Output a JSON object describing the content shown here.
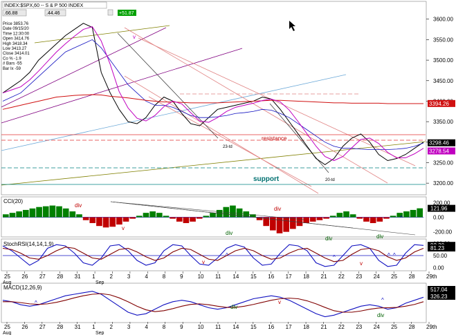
{
  "header": {
    "symbol_box": "INDEX:$SPX,60 -- S & P 500 INDEX",
    "left_val": ".66.88",
    "mid_val": ".44.46",
    "change": "+51.87"
  },
  "info": [
    "Price 3853.76",
    "Date 09/15/20",
    "Time 12:30:00",
    "Open 3414.76",
    "High 3418.34",
    "Low 3413.27",
    "Close 3414.01",
    "Co % -1.9",
    "# Bars -55",
    "Bar Ix -59"
  ],
  "chart_data": [
    {
      "type": "line",
      "panel": "price",
      "title": "",
      "ylim": [
        3175,
        3640
      ],
      "yticks": [
        3200,
        3250,
        3300,
        3350,
        3400,
        3450,
        3500,
        3550,
        3600
      ],
      "series": [
        {
          "values": [
            3420,
            3435,
            3450,
            3470,
            3500,
            3520,
            3540,
            3560,
            3575,
            3590,
            3580,
            3470,
            3420,
            3380,
            3350,
            3345,
            3360,
            3390,
            3410,
            3400,
            3370,
            3345,
            3340,
            3360,
            3380,
            3385,
            3390,
            3395,
            3400,
            3410,
            3405,
            3380,
            3350,
            3320,
            3290,
            3260,
            3245,
            3260,
            3290,
            3310,
            3320,
            3300,
            3270,
            3255,
            3260,
            3270,
            3285,
            3300
          ]
        },
        {
          "values": [
            3400,
            3410,
            3420,
            3440,
            3460,
            3480,
            3500,
            3520,
            3530,
            3540,
            3550,
            3530,
            3500,
            3470,
            3440,
            3420,
            3400,
            3390,
            3390,
            3385,
            3375,
            3365,
            3360,
            3360,
            3362,
            3365,
            3370,
            3372,
            3375,
            3380,
            3378,
            3370,
            3360,
            3345,
            3330,
            3315,
            3300,
            3290,
            3285,
            3285,
            3283,
            3282,
            3282,
            3282,
            3283,
            3285,
            3290,
            3298
          ]
        },
        {
          "values": [
            3380,
            3385,
            3390,
            3395,
            3400,
            3405,
            3410,
            3412,
            3414,
            3415,
            3416,
            3415,
            3412,
            3410,
            3408,
            3405,
            3402,
            3400,
            3398,
            3398,
            3397,
            3396,
            3396,
            3396,
            3396,
            3397,
            3398,
            3399,
            3400,
            3401,
            3402,
            3402,
            3401,
            3400,
            3399,
            3398,
            3397,
            3396,
            3396,
            3395,
            3395,
            3395,
            3395,
            3394,
            3394,
            3394,
            3394,
            3394
          ]
        }
      ],
      "labels": [
        {
          "text": "resistance",
          "color": "#c00000"
        },
        {
          "text": "support",
          "color": "#007070"
        },
        {
          "text": "23-td",
          "color": "#000000"
        },
        {
          "text": "20-td",
          "color": "#000000"
        },
        {
          "text": "v",
          "color": "#c000c0"
        }
      ],
      "price_tags": [
        {
          "text": "3394.26",
          "bg": "#d01010",
          "fg": "#ffffff"
        },
        {
          "text": "3298.46",
          "bg": "#000000",
          "fg": "#ffffff"
        },
        {
          "text": "3278.54",
          "bg": "#c000c0",
          "fg": "#ffffff"
        }
      ]
    },
    {
      "type": "bar",
      "panel": "cci",
      "title": "CCI(20)",
      "ylim": [
        -260,
        260
      ],
      "yticks": [
        200,
        0,
        -200
      ],
      "ytick_labels": [
        "200.00",
        "0.00",
        "-200.00"
      ],
      "values": [
        40,
        60,
        80,
        100,
        120,
        140,
        150,
        160,
        150,
        120,
        80,
        40,
        -40,
        -80,
        -120,
        -140,
        -130,
        -100,
        -60,
        -20,
        20,
        60,
        80,
        60,
        20,
        -20,
        -60,
        -80,
        -60,
        -20,
        20,
        60,
        100,
        140,
        160,
        120,
        80,
        40,
        -40,
        -120,
        -180,
        -220,
        -200,
        -160,
        -120,
        -80,
        -60,
        -40,
        -20,
        20,
        60,
        80,
        40,
        -20,
        -60,
        -80,
        -60,
        -20,
        20,
        60,
        80,
        100,
        122
      ],
      "labels": [
        {
          "text": "div",
          "color": "#c00000"
        },
        {
          "text": "v",
          "color": "#c00000"
        },
        {
          "text": "div",
          "color": "#006000"
        },
        {
          "text": "div",
          "color": "#c00000"
        },
        {
          "text": "div",
          "color": "#006000"
        },
        {
          "text": "div",
          "color": "#006000"
        },
        {
          "text": "^",
          "color": "#0000c0"
        }
      ],
      "price_tag": {
        "text": "121.96",
        "bg": "#000000",
        "fg": "#ffffff"
      }
    },
    {
      "type": "line",
      "panel": "stoch",
      "title": "StochRSI(14,14,1,9)",
      "ylim": [
        -10,
        110
      ],
      "yticks": [
        100,
        50,
        0
      ],
      "ytick_labels": [
        "100.00",
        "50.00",
        "0.00"
      ],
      "series": [
        {
          "values": [
            90,
            70,
            40,
            10,
            30,
            80,
            95,
            90,
            60,
            20,
            10,
            40,
            90,
            95,
            70,
            30,
            10,
            20,
            70,
            95,
            90,
            50,
            15,
            10,
            40,
            80,
            95,
            85,
            40,
            10,
            15,
            60,
            95,
            90,
            70,
            20,
            5,
            10,
            50,
            90,
            95,
            80,
            30,
            5,
            10,
            60,
            95,
            92
          ]
        },
        {
          "values": [
            80,
            75,
            60,
            40,
            35,
            50,
            70,
            85,
            80,
            60,
            40,
            35,
            55,
            75,
            80,
            65,
            45,
            30,
            40,
            65,
            80,
            75,
            55,
            35,
            30,
            50,
            70,
            80,
            70,
            50,
            35,
            40,
            60,
            75,
            80,
            60,
            40,
            25,
            30,
            55,
            75,
            80,
            70,
            45,
            30,
            40,
            65,
            80
          ]
        }
      ],
      "labels": [
        {
          "text": "v",
          "color": "#c00000"
        },
        {
          "text": "^",
          "color": "#0000c0"
        },
        {
          "text": "^",
          "color": "#0000c0"
        },
        {
          "text": "v",
          "color": "#c00000"
        },
        {
          "text": "^",
          "color": "#0000c0"
        },
        {
          "text": "^",
          "color": "#0000c0"
        }
      ],
      "price_tags": [
        {
          "text": "92.30",
          "bg": "#000000",
          "fg": "#ffffff"
        },
        {
          "text": "81.23",
          "bg": "#000000",
          "fg": "#ffffff"
        }
      ]
    },
    {
      "type": "line",
      "panel": "macd",
      "title": "MACD(12,26,9)",
      "ylim": [
        -60,
        60
      ],
      "series": [
        {
          "values": [
            10,
            5,
            -5,
            -10,
            -5,
            5,
            15,
            25,
            30,
            35,
            40,
            30,
            10,
            -10,
            -30,
            -40,
            -35,
            -20,
            -5,
            5,
            10,
            5,
            -5,
            -15,
            -20,
            -15,
            -5,
            5,
            15,
            20,
            25,
            20,
            10,
            -5,
            -20,
            -35,
            -45,
            -40,
            -30,
            -20,
            -10,
            -5,
            -10,
            -20,
            -15,
            0,
            10,
            20
          ]
        },
        {
          "values": [
            5,
            5,
            2,
            -2,
            -4,
            -2,
            3,
            10,
            18,
            25,
            30,
            32,
            28,
            18,
            5,
            -10,
            -22,
            -28,
            -25,
            -18,
            -10,
            -4,
            -2,
            -5,
            -10,
            -14,
            -14,
            -10,
            -4,
            3,
            10,
            15,
            17,
            15,
            8,
            -2,
            -14,
            -25,
            -30,
            -30,
            -26,
            -20,
            -16,
            -15,
            -14,
            -10,
            -4,
            5
          ]
        }
      ],
      "labels": [
        {
          "text": "^",
          "color": "#0000c0"
        },
        {
          "text": "div",
          "color": "#006000"
        },
        {
          "text": "v",
          "color": "#c00000"
        },
        {
          "text": "^",
          "color": "#0000c0"
        },
        {
          "text": "div",
          "color": "#006000"
        }
      ],
      "price_tags": [
        {
          "text": "517.04",
          "bg": "#000000",
          "fg": "#ffffff"
        },
        {
          "text": "326.23",
          "bg": "#000000",
          "fg": "#ffffff"
        }
      ]
    }
  ],
  "x_axis": {
    "ticks": [
      "25",
      "26",
      "27",
      "28",
      "31",
      "1",
      "2",
      "3",
      "4",
      "8",
      "9",
      "10",
      "11",
      "14",
      "15",
      "16",
      "17",
      "18",
      "21",
      "22",
      "23",
      "24",
      "25",
      "28",
      "29th"
    ],
    "month_labels": [
      "Aug",
      "Sep"
    ]
  },
  "colors": {
    "accent_red": "#d01010",
    "magenta": "#c000c0",
    "blue": "#1010c0",
    "olive": "#808000",
    "teal": "#008080"
  }
}
